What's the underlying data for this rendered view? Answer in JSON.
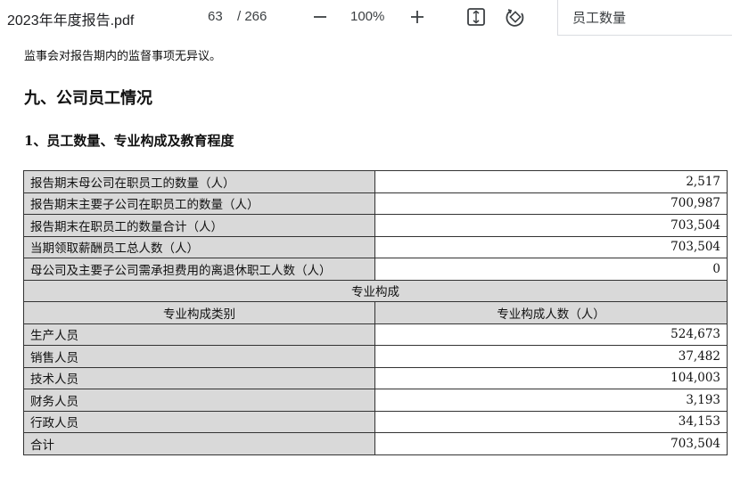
{
  "toolbar": {
    "title": "2023年年度报告.pdf",
    "page_current": "63",
    "page_total": "/ 266",
    "zoom": "100%",
    "search_value": "员工数量"
  },
  "document": {
    "intro": "监事会对报告期内的监督事项无异议。",
    "heading": "九、公司员工情况",
    "subheading": "1、员工数量、专业构成及教育程度",
    "rows": [
      {
        "label": "报告期末母公司在职员工的数量（人）",
        "value": "2,517"
      },
      {
        "label": "报告期末主要子公司在职员工的数量（人）",
        "value": "700,987"
      },
      {
        "label": "报告期末在职员工的数量合计（人）",
        "value": "703,504"
      },
      {
        "label": "当期领取薪酬员工总人数（人）",
        "value": "703,504"
      },
      {
        "label": "母公司及主要子公司需承担费用的离退休职工人数（人）",
        "value": "0"
      }
    ],
    "section_title": "专业构成",
    "col1_header": "专业构成类别",
    "col2_header": "专业构成人数（人）",
    "categories": [
      {
        "label": "生产人员",
        "value": "524,673"
      },
      {
        "label": "销售人员",
        "value": "37,482"
      },
      {
        "label": "技术人员",
        "value": "104,003"
      },
      {
        "label": "财务人员",
        "value": "3,193"
      },
      {
        "label": "行政人员",
        "value": "34,153"
      },
      {
        "label": "合计",
        "value": "703,504"
      }
    ]
  },
  "icons": [
    "minus-icon",
    "plus-icon",
    "fit-page-icon",
    "rotate-icon"
  ]
}
